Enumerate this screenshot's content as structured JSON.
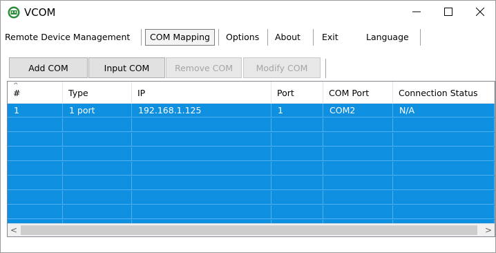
{
  "window": {
    "title": "VCOM",
    "min_icon": "minimize-icon",
    "max_icon": "maximize-icon",
    "close_icon": "close-icon",
    "app_icon": "vcom-app-icon"
  },
  "menu": {
    "items": [
      {
        "label": "Remote Device Management"
      },
      {
        "label": "COM Mapping",
        "selected": true
      },
      {
        "label": "Options"
      },
      {
        "label": "About"
      },
      {
        "label": "Exit"
      },
      {
        "label": "Language"
      }
    ]
  },
  "toolbar": {
    "add_com": "Add COM",
    "input_com": "Input COM",
    "remove_com": "Remove COM",
    "modify_com": "Modify COM"
  },
  "table": {
    "sort_indicator": "^",
    "columns": [
      "#",
      "Type",
      "IP",
      "Port",
      "COM Port",
      "Connection Status"
    ],
    "rows": [
      [
        "1",
        "1 port",
        "192.168.1.125",
        "1",
        "COM2",
        "N/A"
      ]
    ],
    "selection_color": "#0f8fe0"
  },
  "scrollbar": {
    "left_arrow": "<",
    "right_arrow": ">"
  }
}
